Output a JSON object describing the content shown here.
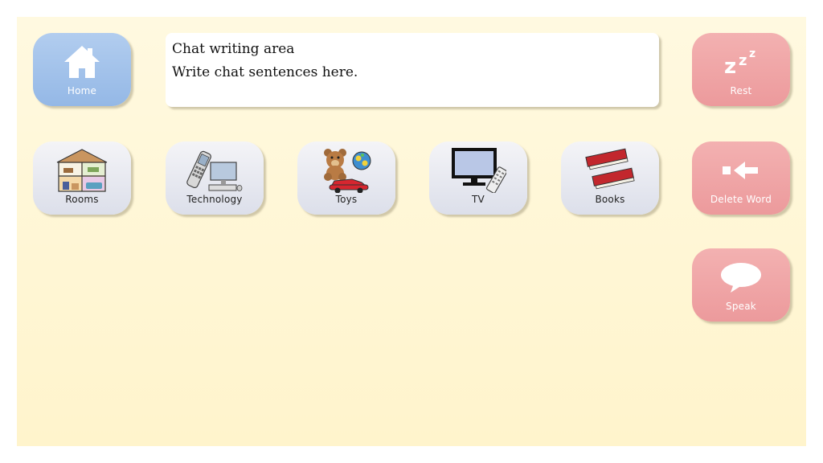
{
  "chat": {
    "title": "Chat writing area",
    "placeholder": "Write chat sentences here."
  },
  "left": {
    "home_label": "Home"
  },
  "right": {
    "rest_label": "Rest",
    "delete_label": "Delete Word",
    "speak_label": "Speak"
  },
  "categories": [
    {
      "label": "Rooms",
      "icon": "house-rooms-icon"
    },
    {
      "label": "Technology",
      "icon": "phone-computer-icon"
    },
    {
      "label": "Toys",
      "icon": "teddy-ball-car-icon"
    },
    {
      "label": "TV",
      "icon": "tv-remote-icon"
    },
    {
      "label": "Books",
      "icon": "books-icon"
    }
  ],
  "colors": {
    "home_button": "#a3c3eb",
    "action_button": "#f0a5a7",
    "category_button": "#e8e9f0",
    "background": "#fff6d6"
  }
}
